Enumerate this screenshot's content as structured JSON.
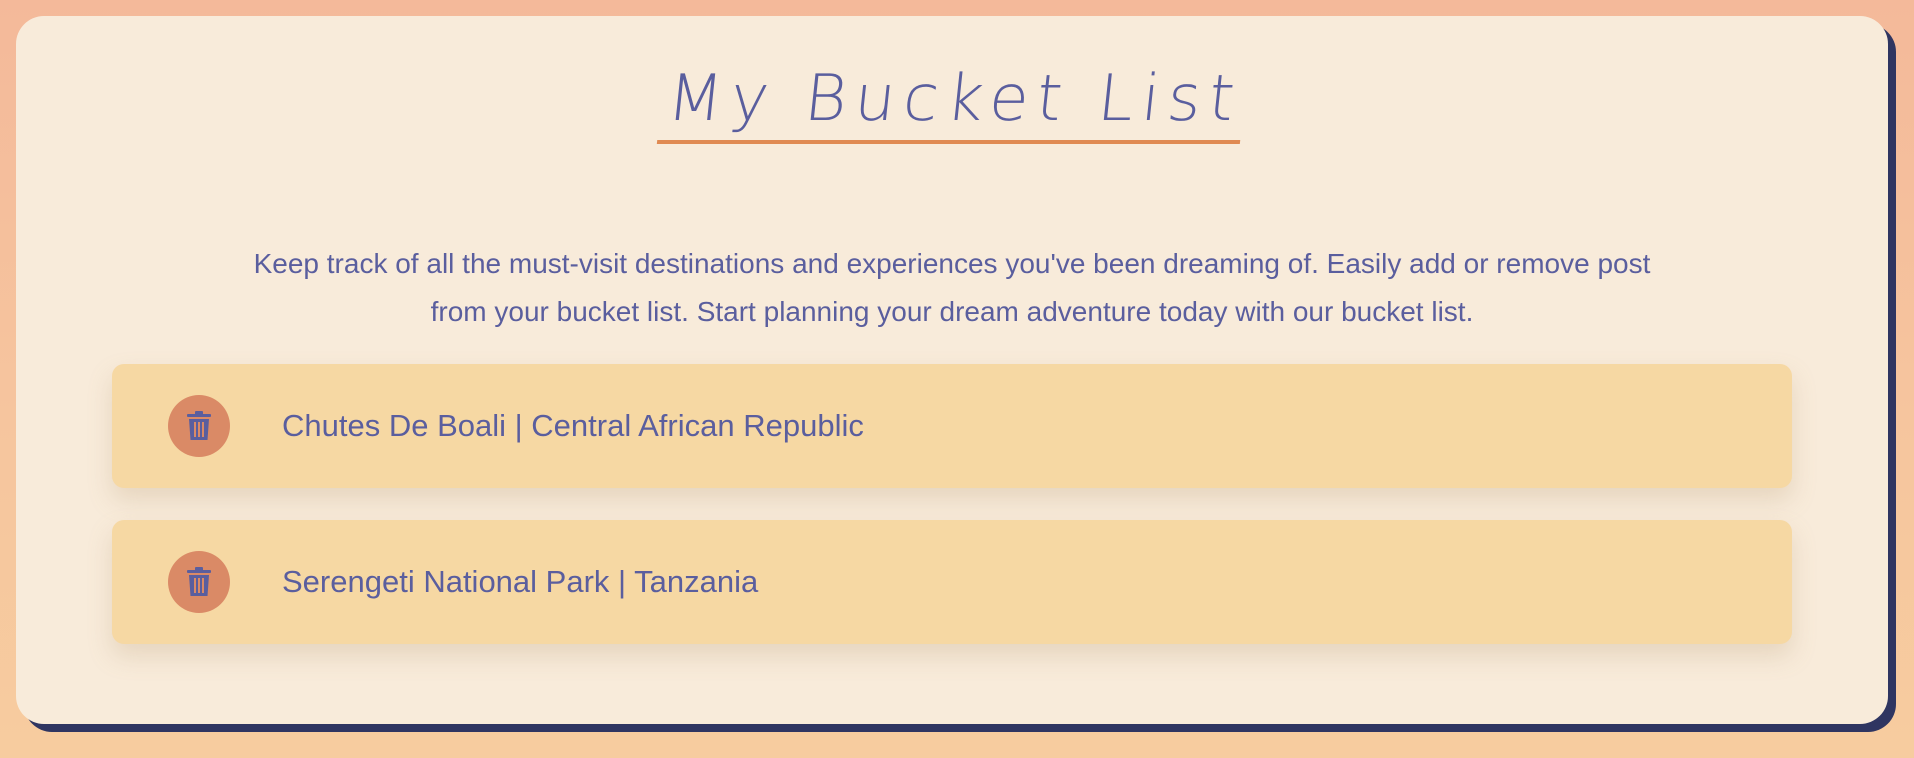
{
  "title": "My Bucket List",
  "description": "Keep track of all the must-visit destinations and experiences you've been dreaming of. Easily add or remove post from your bucket list. Start planning your dream adventure today with our bucket list.",
  "items": [
    {
      "label": "Chutes De Boali | Central African Republic",
      "icon": "trash-icon"
    },
    {
      "label": "Serengeti National Park | Tanzania",
      "icon": "trash-icon"
    }
  ],
  "colors": {
    "background": "#f4b99a",
    "card": "#f8ebda",
    "card_shadow": "#2f3561",
    "text": "#5a5e9e",
    "accent": "#e08a52",
    "item_background": "#f6d8a3",
    "delete_button": "#da8a66"
  }
}
